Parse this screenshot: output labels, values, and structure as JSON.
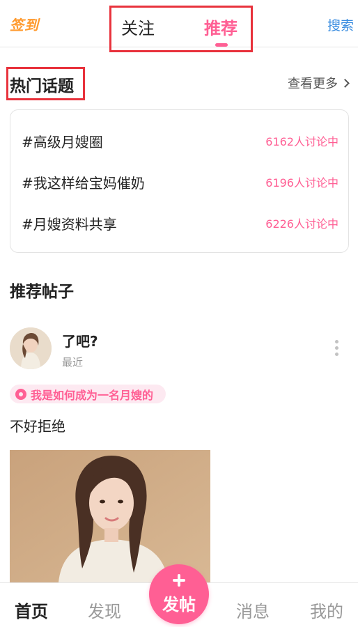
{
  "header": {
    "signin_label": "签到",
    "tabs": [
      {
        "label": "关注",
        "active": false
      },
      {
        "label": "推荐",
        "active": true
      }
    ],
    "search_label": "搜索"
  },
  "hot_topics": {
    "title": "热门话题",
    "more_label": "查看更多",
    "items": [
      {
        "name": "#高级月嫂圈",
        "count": "6162人讨论中"
      },
      {
        "name": "#我这样给宝妈催奶",
        "count": "6196人讨论中"
      },
      {
        "name": "#月嫂资料共享",
        "count": "6226人讨论中"
      }
    ]
  },
  "recommended": {
    "title": "推荐帖子",
    "post": {
      "username": "了吧?",
      "time": "最近",
      "tag": "我是如何成为一名月嫂的",
      "text": "不好拒绝"
    }
  },
  "bottom_nav": {
    "home": "首页",
    "discover": "发现",
    "post": "发帖",
    "messages": "消息",
    "mine": "我的"
  },
  "colors": {
    "accent_pink": "#ff5f94",
    "signin_orange": "#ff9a2e",
    "search_blue": "#3a8de0",
    "highlight_red": "#e8323c"
  }
}
